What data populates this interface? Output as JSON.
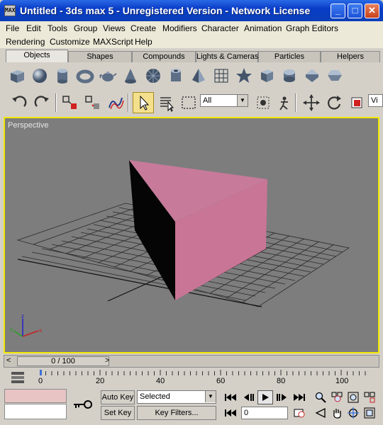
{
  "window": {
    "title": "Untitled - 3ds max 5 - Unregistered Version - Network License",
    "icon_text": "MAX",
    "controls": {
      "minimize": "_",
      "maximize": "□",
      "close": "✕"
    }
  },
  "menu_row1": [
    "File",
    "Edit",
    "Tools",
    "Group",
    "Views",
    "Create",
    "Modifiers",
    "Character",
    "Animation",
    "Graph Editors"
  ],
  "menu_row2": [
    "Rendering",
    "Customize",
    "MAXScript",
    "Help"
  ],
  "tabs": [
    {
      "label": "Objects",
      "active": true
    },
    {
      "label": "Shapes",
      "active": false
    },
    {
      "label": "Compounds",
      "active": false
    },
    {
      "label": "Lights & Cameras",
      "active": false
    },
    {
      "label": "Particles",
      "active": false
    },
    {
      "label": "Helpers",
      "active": false
    }
  ],
  "object_buttons": [
    "box-icon",
    "sphere-icon",
    "cylinder-icon",
    "torus-icon",
    "teapot-icon",
    "cone-icon",
    "geosphere-icon",
    "tube-icon",
    "pyramid-icon",
    "plane-icon",
    "hedra-icon",
    "chamferbox-icon",
    "oiltank-icon",
    "spindle-icon",
    "gengon-icon"
  ],
  "main_toolbar": {
    "selection_filter": "All",
    "named_sel_partial": "Vi"
  },
  "viewport": {
    "label": "Perspective",
    "axis_labels": {
      "x": "x",
      "y": "y",
      "z": "z"
    },
    "colors": {
      "border": "#f2e700",
      "background": "#7d7d7d",
      "object": "#c87596"
    }
  },
  "timeline": {
    "slider_label": "0 / 100",
    "prev": "<",
    "next": ">",
    "ticks": [
      "0",
      "20",
      "40",
      "60",
      "80",
      "100"
    ]
  },
  "bottom": {
    "auto_key": "Auto Key",
    "set_key": "Set Key",
    "key_mode_value": "Selected",
    "key_filters": "Key Filters...",
    "frame_value": "0"
  }
}
